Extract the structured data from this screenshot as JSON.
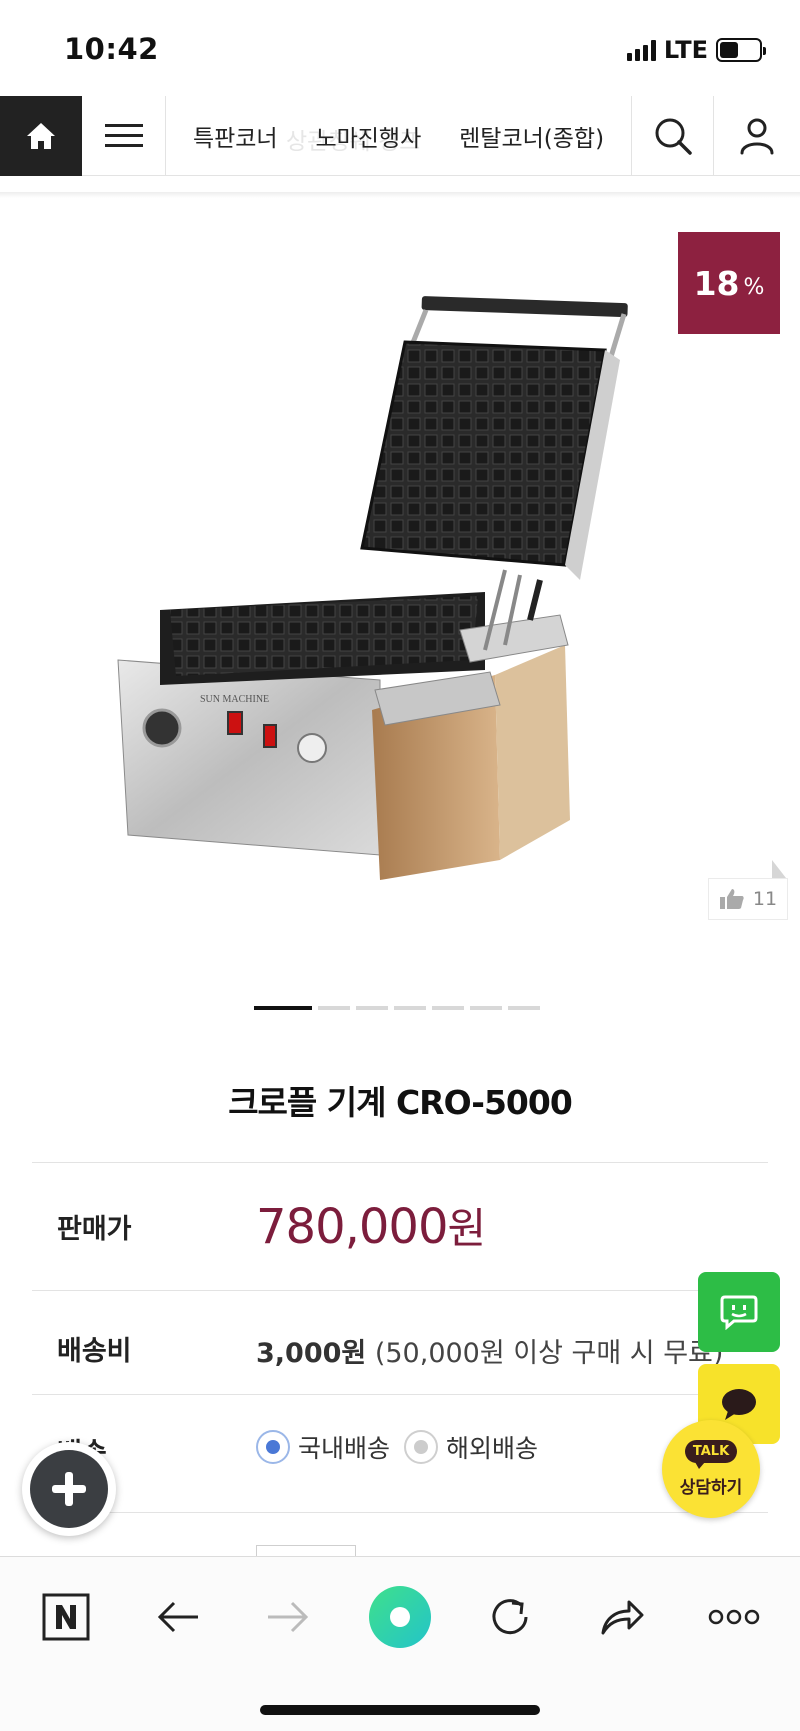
{
  "status_bar": {
    "time": "10:42",
    "network": "LTE"
  },
  "nav": {
    "links": [
      "특판코너",
      "노마진행사",
      "렌탈코너(종합)"
    ],
    "ghost_text": "상관칭쉐 경프"
  },
  "product": {
    "discount_value": "18",
    "discount_unit": "%",
    "likes": "11",
    "title": "크로플 기계 CRO-5000",
    "image_labels": {
      "brand": "SUN MACHINE"
    },
    "slide_count": 7,
    "active_slide": 1
  },
  "info": {
    "price_label": "판매가",
    "price_value": "780,000",
    "price_unit": "원",
    "shipping_label": "배송비",
    "shipping_fee": "3,000원",
    "shipping_note": "(50,000원 이상 구매 시 무료)",
    "delivery_label": "배송",
    "delivery_options": [
      "국내배송",
      "해외배송"
    ],
    "delivery_selected": 0
  },
  "floating": {
    "kakao_talk": "TALK",
    "kakao_label": "상담하기"
  },
  "colors": {
    "accent": "#7c1d3c",
    "badge": "#8d2140",
    "chat_green": "#2dbd46",
    "kakao_yellow": "#fbe234"
  }
}
